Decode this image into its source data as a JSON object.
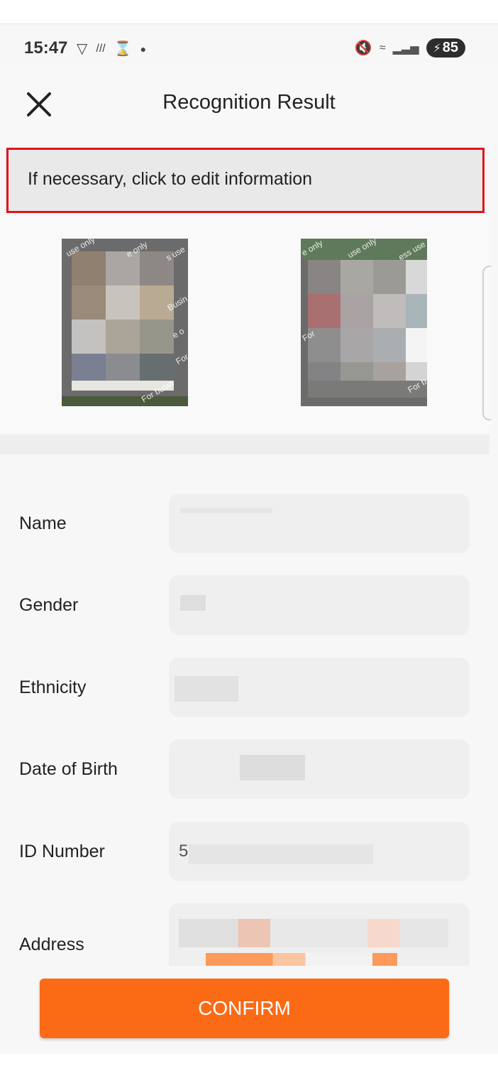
{
  "status_bar": {
    "time": "15:47",
    "battery": "85",
    "icons_left": [
      "shield-v-icon",
      "signal-lines-icon",
      "hourglass-icon",
      "dot-icon"
    ],
    "icons_right": [
      "mute-icon",
      "wifi-icon",
      "cell-signal-icon",
      "battery-icon"
    ]
  },
  "header": {
    "title": "Recognition Result",
    "close_icon": "close-icon"
  },
  "notice": {
    "text": "If necessary, click to edit information",
    "border_color": "#e0141b"
  },
  "photos": {
    "watermark": "For business use only",
    "watermark_front_partial": [
      "use only",
      "e only",
      "s use",
      "Busin",
      "e o",
      "For b",
      "For busin"
    ],
    "watermark_back_partial": [
      "e only",
      "use only",
      "ess use",
      "For",
      "For b"
    ]
  },
  "form": {
    "fields": [
      {
        "label": "Name",
        "value": ""
      },
      {
        "label": "Gender",
        "value": ""
      },
      {
        "label": "Ethnicity",
        "value": ""
      },
      {
        "label": "Date of Birth",
        "value": ""
      },
      {
        "label": "ID Number",
        "value": "5"
      },
      {
        "label": "Address",
        "value": ""
      }
    ]
  },
  "confirm": {
    "label": "CONFIRM",
    "color": "#fb6a15"
  }
}
